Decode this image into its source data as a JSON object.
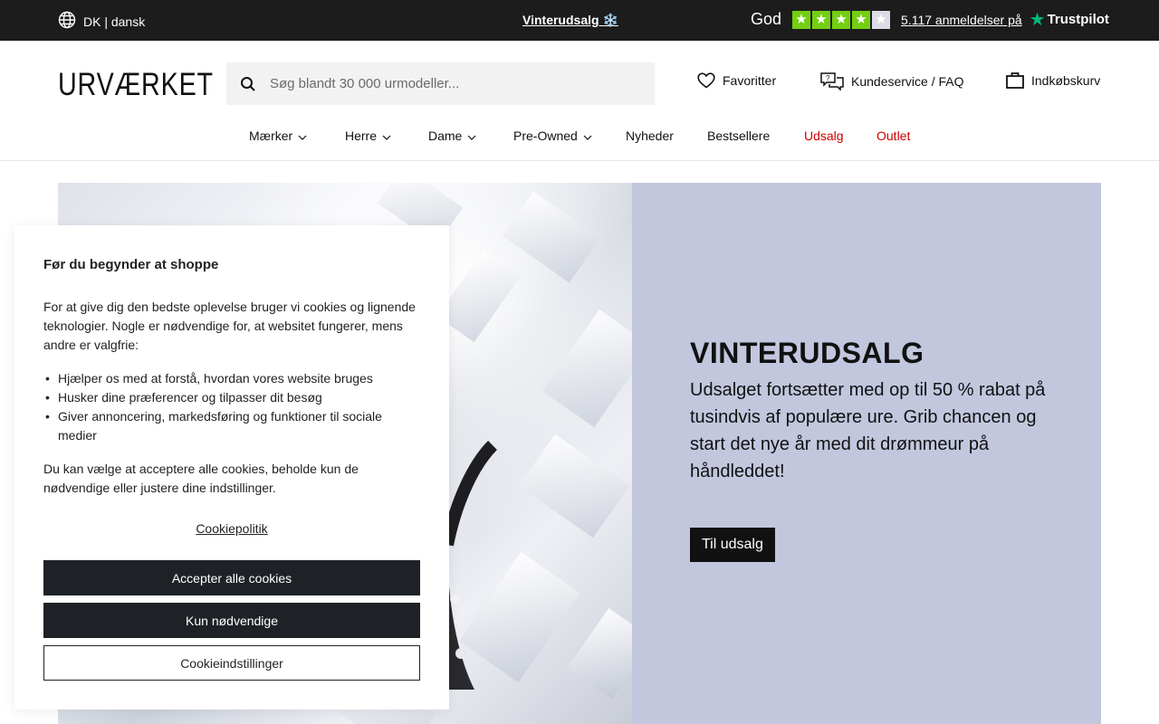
{
  "topbar": {
    "language": "DK | dansk",
    "promo": "Vinterudsalg",
    "promo_emoji": "❄️",
    "trustpilot": {
      "rating_word": "God",
      "stars_filled": 4,
      "stars_total": 5,
      "reviews": "5.117 anmeldelser på",
      "brand": "Trustpilot"
    }
  },
  "header": {
    "logo": "URVÆRKET",
    "search_placeholder": "Søg blandt 30 000 urmodeller...",
    "favorites": "Favoritter",
    "support": "Kundeservice / FAQ",
    "cart": "Indkøbskurv"
  },
  "nav": {
    "items": [
      {
        "label": "Mærker",
        "dropdown": true
      },
      {
        "label": "Herre",
        "dropdown": true
      },
      {
        "label": "Dame",
        "dropdown": true
      },
      {
        "label": "Pre-Owned",
        "dropdown": true
      },
      {
        "label": "Nyheder",
        "dropdown": false
      },
      {
        "label": "Bestsellere",
        "dropdown": false
      },
      {
        "label": "Udsalg",
        "dropdown": false,
        "color": "#cc0000"
      },
      {
        "label": "Outlet",
        "dropdown": false,
        "color": "#cc0000"
      }
    ]
  },
  "hero": {
    "title": "VINTERUDSALG",
    "text": "Udsalget fortsætter med op til 50 % rabat på tusindvis af populære ure. Grib chancen og start det nye år med dit drømmeur på håndleddet!",
    "button": "Til udsalg",
    "panel_color": "#c2c7de"
  },
  "cookie": {
    "title": "Før du begynder at shoppe",
    "intro": "For at give dig den bedste oplevelse bruger vi cookies og lignende teknologier. Nogle er nødvendige for, at websitet fungerer, mens andre er valgfrie:",
    "bullets": [
      "Hjælper os med at forstå, hvordan vores website bruges",
      "Husker dine præferencer og tilpasser dit besøg",
      "Giver annoncering, markedsføring og funktioner til sociale medier"
    ],
    "choice": "Du kan vælge at acceptere alle cookies, beholde kun de nødvendige eller justere dine indstillinger.",
    "policy_link": "Cookiepolitik",
    "accept_all": "Accepter alle cookies",
    "necessary_only": "Kun nødvendige",
    "settings": "Cookieindstillinger"
  }
}
